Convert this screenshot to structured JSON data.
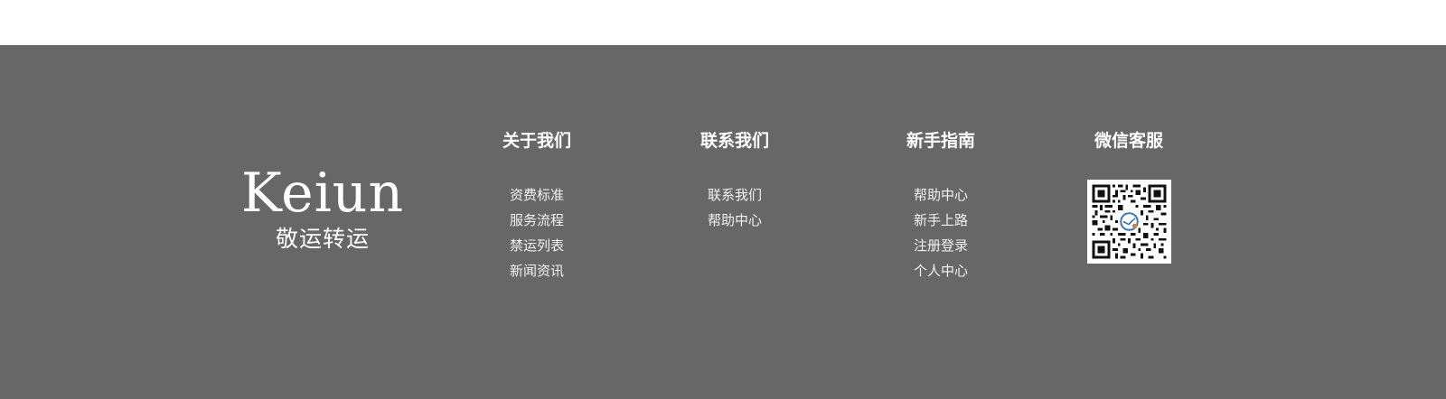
{
  "logo": {
    "brand_en": "Keiun",
    "brand_cn": "敬运转运"
  },
  "columns": [
    {
      "title": "关于我们",
      "links": [
        "资费标准",
        "服务流程",
        "禁运列表",
        "新闻资讯"
      ]
    },
    {
      "title": "联系我们",
      "links": [
        "联系我们",
        "帮助中心"
      ]
    },
    {
      "title": "新手指南",
      "links": [
        "帮助中心",
        "新手上路",
        "注册登录",
        "个人中心"
      ]
    },
    {
      "title": "微信客服"
    }
  ],
  "colors": {
    "footer_bg": "#676767",
    "text": "#ffffff"
  },
  "icons": {
    "qr": "wechat-qr-code"
  }
}
